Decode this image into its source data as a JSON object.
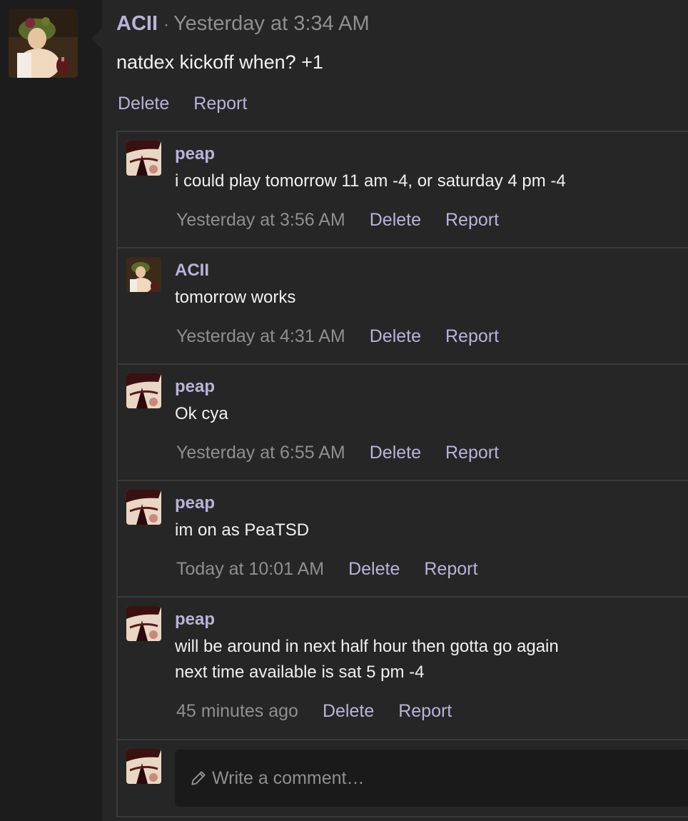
{
  "post": {
    "author": "ACII",
    "separator": "·",
    "time": "Yesterday at 3:34 AM",
    "text": "natdex kickoff when? +1",
    "actions": [
      "Delete",
      "Report"
    ]
  },
  "comments": [
    {
      "author": "peap",
      "text": "i could play tomorrow 11 am -4, or saturday 4 pm -4",
      "time": "Yesterday at 3:56 AM",
      "delete": "Delete",
      "report": "Report"
    },
    {
      "author": "ACII",
      "text": "tomorrow works",
      "time": "Yesterday at 4:31 AM",
      "delete": "Delete",
      "report": "Report"
    },
    {
      "author": "peap",
      "text": "Ok cya",
      "time": "Yesterday at 6:55 AM",
      "delete": "Delete",
      "report": "Report"
    },
    {
      "author": "peap",
      "text": "im on as PeaTSD",
      "time": "Today at 10:01 AM",
      "delete": "Delete",
      "report": "Report"
    },
    {
      "author": "peap",
      "text_line1": "will be around in next half hour then gotta go again",
      "text_line2": "next time available is sat 5 pm -4",
      "time": "45 minutes ago",
      "delete": "Delete",
      "report": "Report"
    }
  ],
  "composer": {
    "placeholder": "Write a comment…",
    "icon": "pencil-icon"
  },
  "colors": {
    "accent": "#b9b3d9",
    "muted": "#8f8f8f",
    "panel": "#262626",
    "background": "#1c1c1c"
  }
}
